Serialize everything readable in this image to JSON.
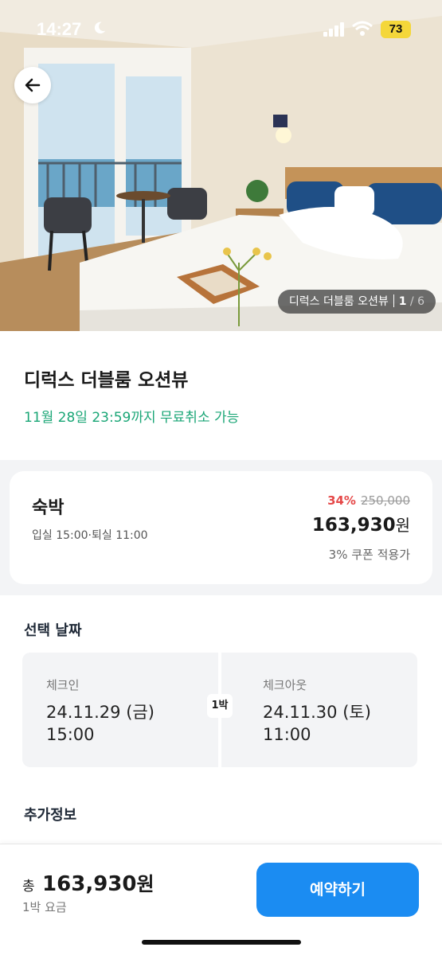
{
  "status_bar": {
    "time": "14:27",
    "battery": "73"
  },
  "hero": {
    "caption_name": "디럭스 더블룸 오션뷰",
    "photo_index": "1",
    "photo_total": "/ 6"
  },
  "room": {
    "title": "디럭스 더블룸 오션뷰",
    "cancel_note": "11월 28일 23:59까지 무료취소 가능"
  },
  "price_card": {
    "stay_label": "숙박",
    "stay_time": "입실 15:00·퇴실 11:00",
    "discount": "34%",
    "original_price": "250,000",
    "final_price": "163,930",
    "currency": "원",
    "coupon_note": "3% 쿠폰 적용가"
  },
  "dates": {
    "section_title": "선택 날짜",
    "checkin_label": "체크인",
    "checkin_date": "24.11.29 (금)",
    "checkin_time": "15:00",
    "nights": "1박",
    "checkout_label": "체크아웃",
    "checkout_date": "24.11.30 (토)",
    "checkout_time": "11:00"
  },
  "extra": {
    "section_title": "추가정보"
  },
  "bottom": {
    "total_prefix": "총",
    "total_amount": "163,930",
    "currency": "원",
    "per_night": "1박 요금",
    "reserve_label": "예약하기"
  },
  "colors": {
    "accent": "#1b8cf2",
    "cancel_green": "#1aa676",
    "discount_red": "#e54848"
  }
}
